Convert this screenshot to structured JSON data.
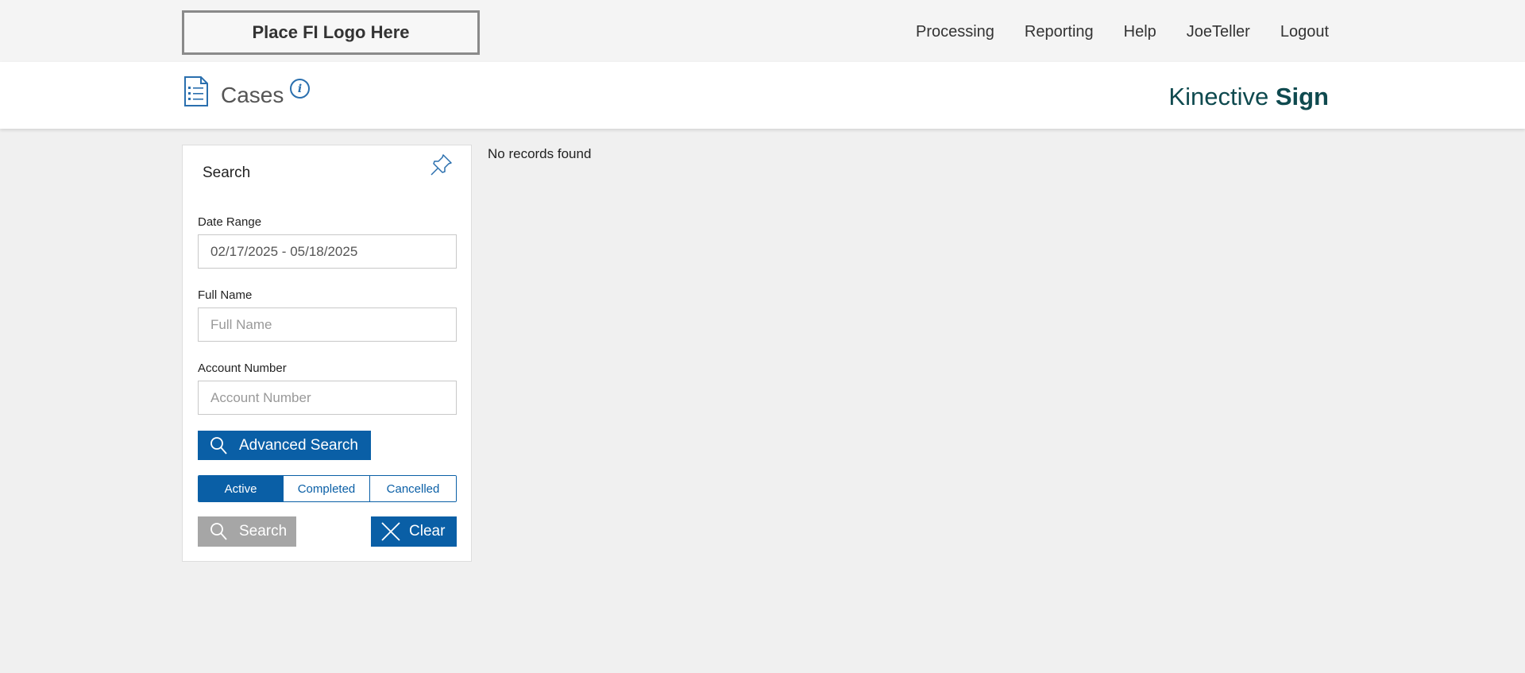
{
  "topbar": {
    "logo_text": "Place FI Logo Here",
    "nav": [
      "Processing",
      "Reporting",
      "Help",
      "JoeTeller",
      "Logout"
    ]
  },
  "header": {
    "title": "Cases",
    "info_icon": "info-icon",
    "brand_light": "Kinective",
    "brand_bold": "Sign"
  },
  "search_panel": {
    "title": "Search",
    "date_range": {
      "label": "Date Range",
      "value": "02/17/2025 - 05/18/2025"
    },
    "full_name": {
      "label": "Full Name",
      "placeholder": "Full Name",
      "value": ""
    },
    "account_number": {
      "label": "Account Number",
      "placeholder": "Account Number",
      "value": ""
    },
    "advanced_search_label": "Advanced Search",
    "status_tabs": [
      {
        "label": "Active",
        "selected": true
      },
      {
        "label": "Completed",
        "selected": false
      },
      {
        "label": "Cancelled",
        "selected": false
      }
    ],
    "search_label": "Search",
    "clear_label": "Clear"
  },
  "results": {
    "message": "No records found"
  },
  "colors": {
    "primary": "#0a5fa6",
    "disabled": "#a6a6a6",
    "brand": "#0f4a4f"
  }
}
